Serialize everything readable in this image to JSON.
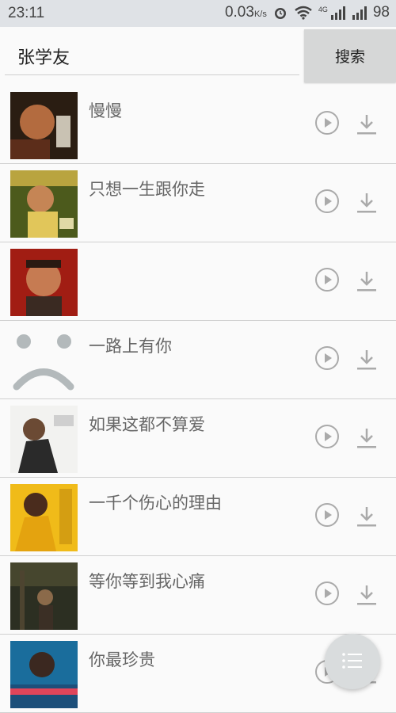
{
  "statusbar": {
    "time": "23:11",
    "speed": "0.03",
    "speed_unit": "K/s",
    "network": "4G",
    "battery": "98"
  },
  "search": {
    "value": "张学友",
    "button_label": "搜索"
  },
  "songs": [
    {
      "title": "慢慢"
    },
    {
      "title": "只想一生跟你走"
    },
    {
      "title": ""
    },
    {
      "title": "一路上有你"
    },
    {
      "title": "如果这都不算爱"
    },
    {
      "title": "一千个伤心的理由"
    },
    {
      "title": "等你等到我心痛"
    },
    {
      "title": "你最珍贵"
    }
  ],
  "icons": {
    "play": "play-circle-icon",
    "download": "download-icon",
    "fab": "playlist-icon",
    "placeholder": "sad-face-icon"
  },
  "colors": {
    "statusbar": "#dfe2e6",
    "icon": "#aaaaaa",
    "button": "#d6d7d7"
  }
}
